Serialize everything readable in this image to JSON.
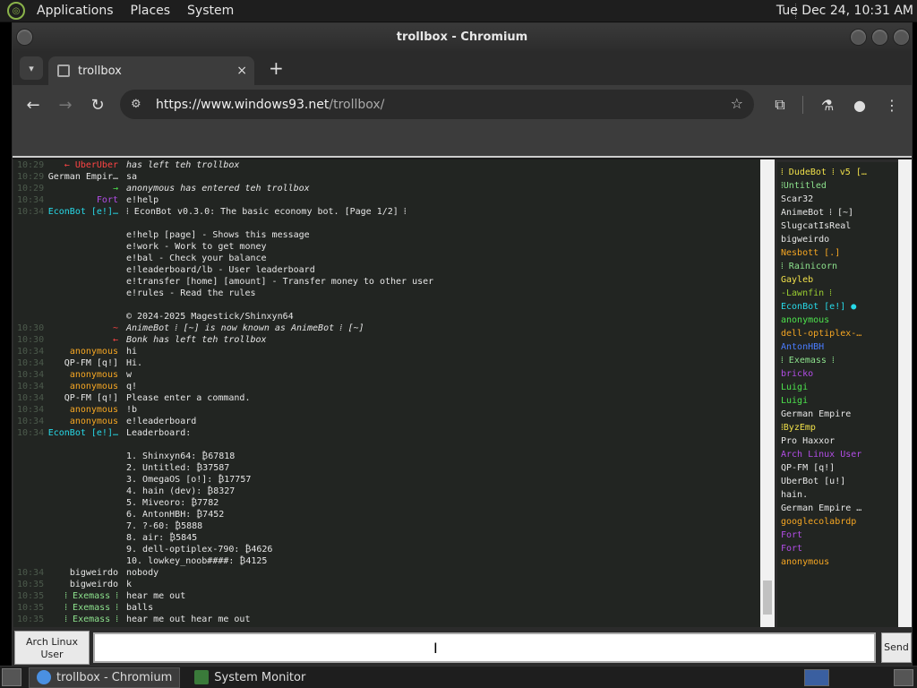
{
  "top_panel": {
    "menus": [
      "Applications",
      "Places",
      "System"
    ],
    "clock": "Tue Dec 24, 10:31 AM"
  },
  "window": {
    "title": "trollbox - Chromium"
  },
  "browser": {
    "tab_title": "trollbox",
    "tab_close": "×",
    "new_tab": "+",
    "url_host": "https://www.windows93.net",
    "url_path": "/trollbox/"
  },
  "chat": {
    "messages": [
      {
        "ts": "10:29",
        "nick": "←  UberUber",
        "nick_color": "red",
        "text": "has left teh trollbox",
        "italic": true
      },
      {
        "ts": "10:29",
        "nick": "German Empir…",
        "nick_color": "white",
        "text": "sa",
        "italic": false
      },
      {
        "ts": "10:29",
        "nick": "→",
        "nick_color": "green",
        "text": "anonymous has entered teh trollbox",
        "italic": true
      },
      {
        "ts": "10:34",
        "nick": "Fort",
        "nick_color": "purple",
        "text": "e!help",
        "italic": false
      },
      {
        "ts": "10:34",
        "nick": "EconBot [e!]…",
        "nick_color": "cyan",
        "text": "⁞ EconBot v0.3.0: The basic economy bot. [Page 1/2] ⁞",
        "italic": false
      },
      {
        "ts": "",
        "nick": "",
        "nick_color": "white",
        "text": "",
        "italic": false
      },
      {
        "ts": "",
        "nick": "",
        "nick_color": "white",
        "text": "e!help [page] - Shows this message",
        "italic": false
      },
      {
        "ts": "",
        "nick": "",
        "nick_color": "white",
        "text": "e!work - Work to get money",
        "italic": false
      },
      {
        "ts": "",
        "nick": "",
        "nick_color": "white",
        "text": "e!bal - Check your balance",
        "italic": false
      },
      {
        "ts": "",
        "nick": "",
        "nick_color": "white",
        "text": "e!leaderboard/lb - User leaderboard",
        "italic": false
      },
      {
        "ts": "",
        "nick": "",
        "nick_color": "white",
        "text": "e!transfer [home] [amount] - Transfer money to other user",
        "italic": false
      },
      {
        "ts": "",
        "nick": "",
        "nick_color": "white",
        "text": "e!rules - Read the rules",
        "italic": false
      },
      {
        "ts": "",
        "nick": "",
        "nick_color": "white",
        "text": "",
        "italic": false
      },
      {
        "ts": "",
        "nick": "",
        "nick_color": "white",
        "text": "© 2024-2025 Magestick/Shinxyn64",
        "italic": false
      },
      {
        "ts": "10:30",
        "nick": "~",
        "nick_color": "red",
        "text": "AnimeBot ⁞ [~] is now known as AnimeBot ⁞ [~]",
        "italic": true
      },
      {
        "ts": "10:30",
        "nick": "←",
        "nick_color": "red",
        "text": "Bonk has left teh trollbox",
        "italic": true
      },
      {
        "ts": "10:34",
        "nick": "anonymous",
        "nick_color": "orange",
        "text": "hi",
        "italic": false
      },
      {
        "ts": "10:34",
        "nick": "QP-FM [q!]",
        "nick_color": "white",
        "text": "Hi.",
        "italic": false
      },
      {
        "ts": "10:34",
        "nick": "anonymous",
        "nick_color": "orange",
        "text": "w",
        "italic": false
      },
      {
        "ts": "10:34",
        "nick": "anonymous",
        "nick_color": "orange",
        "text": "q!",
        "italic": false
      },
      {
        "ts": "10:34",
        "nick": "QP-FM [q!]",
        "nick_color": "white",
        "text": "Please enter a command.",
        "italic": false
      },
      {
        "ts": "10:34",
        "nick": "anonymous",
        "nick_color": "orange",
        "text": "!b",
        "italic": false
      },
      {
        "ts": "10:34",
        "nick": "anonymous",
        "nick_color": "orange",
        "text": "e!leaderboard",
        "italic": false
      },
      {
        "ts": "10:34",
        "nick": "EconBot [e!]…",
        "nick_color": "cyan",
        "text": "Leaderboard:",
        "italic": false
      },
      {
        "ts": "",
        "nick": "",
        "nick_color": "white",
        "text": "",
        "italic": false
      },
      {
        "ts": "",
        "nick": "",
        "nick_color": "white",
        "text": "1. Shinxyn64: ₿67818",
        "italic": false
      },
      {
        "ts": "",
        "nick": "",
        "nick_color": "white",
        "text": "2. Untitled: ₿37587",
        "italic": false
      },
      {
        "ts": "",
        "nick": "",
        "nick_color": "white",
        "text": "3. OmegaOS [o!]: ₿17757",
        "italic": false
      },
      {
        "ts": "",
        "nick": "",
        "nick_color": "white",
        "text": "4. hain (dev): ₿8327",
        "italic": false
      },
      {
        "ts": "",
        "nick": "",
        "nick_color": "white",
        "text": "5. Miveoro: ₿7782",
        "italic": false
      },
      {
        "ts": "",
        "nick": "",
        "nick_color": "white",
        "text": "6. AntonHBH: ₿7452",
        "italic": false
      },
      {
        "ts": "",
        "nick": "",
        "nick_color": "white",
        "text": "7. ?-60: ₿5888",
        "italic": false
      },
      {
        "ts": "",
        "nick": "",
        "nick_color": "white",
        "text": "8. air: ₿5845",
        "italic": false
      },
      {
        "ts": "",
        "nick": "",
        "nick_color": "white",
        "text": "9. dell-optiplex-790: ₿4626",
        "italic": false
      },
      {
        "ts": "",
        "nick": "",
        "nick_color": "white",
        "text": "10. lowkey_noob####: ₿4125",
        "italic": false
      },
      {
        "ts": "10:34",
        "nick": "bigweirdo",
        "nick_color": "white",
        "text": "nobody",
        "italic": false
      },
      {
        "ts": "10:35",
        "nick": "bigweirdo",
        "nick_color": "white",
        "text": "k",
        "italic": false
      },
      {
        "ts": "10:35",
        "nick": "⁞ Exemass ⁞",
        "nick_color": "lgreen",
        "text": "hear me out",
        "italic": false
      },
      {
        "ts": "10:35",
        "nick": "⁞ Exemass ⁞",
        "nick_color": "lgreen",
        "text": "balls",
        "italic": false
      },
      {
        "ts": "10:35",
        "nick": "⁞ Exemass ⁞",
        "nick_color": "lgreen",
        "text": "hear me out hear me out",
        "italic": false
      }
    ]
  },
  "users": [
    {
      "name": "⁞ DudeBot ⁞ v5 […",
      "color": "yellow"
    },
    {
      "name": "⁞Untitled",
      "color": "lgreen"
    },
    {
      "name": "Scar32",
      "color": "white"
    },
    {
      "name": "AnimeBot ⁞ [~]",
      "color": "white"
    },
    {
      "name": "SlugcatIsReal",
      "color": "white"
    },
    {
      "name": "bigweirdo",
      "color": "white"
    },
    {
      "name": "Nesbott [.]",
      "color": "orange"
    },
    {
      "name": "⁞ Rainicorn",
      "color": "lgreen"
    },
    {
      "name": "Gayleb",
      "color": "yellow"
    },
    {
      "name": "-Lawnfin ⁞",
      "color": "lime"
    },
    {
      "name": "EconBot [e!] ●",
      "color": "cyan"
    },
    {
      "name": "anonymous",
      "color": "green"
    },
    {
      "name": "dell-optiplex-…",
      "color": "orange"
    },
    {
      "name": "AntonHBH",
      "color": "blue"
    },
    {
      "name": "⁞ Exemass ⁞",
      "color": "lgreen"
    },
    {
      "name": "bricko",
      "color": "purple"
    },
    {
      "name": "Luigi",
      "color": "green"
    },
    {
      "name": "Luigi",
      "color": "green"
    },
    {
      "name": "German Empire",
      "color": "white"
    },
    {
      "name": "⁞ByzEmp",
      "color": "yellow"
    },
    {
      "name": "Pro Haxxor",
      "color": "white"
    },
    {
      "name": "Arch Linux User",
      "color": "purple"
    },
    {
      "name": "QP-FM [q!]",
      "color": "white"
    },
    {
      "name": "UberBot [u!]",
      "color": "white"
    },
    {
      "name": "hain.",
      "color": "white"
    },
    {
      "name": "German Empire …",
      "color": "white"
    },
    {
      "name": "googlecolabrdp",
      "color": "orange"
    },
    {
      "name": "Fort",
      "color": "purple"
    },
    {
      "name": "Fort",
      "color": "purple"
    },
    {
      "name": "anonymous",
      "color": "orange"
    }
  ],
  "input": {
    "name_button": "Arch Linux User",
    "message_value": "",
    "send_label": "Send"
  },
  "taskbar": {
    "tasks": [
      "trollbox - Chromium",
      "System Monitor"
    ]
  }
}
